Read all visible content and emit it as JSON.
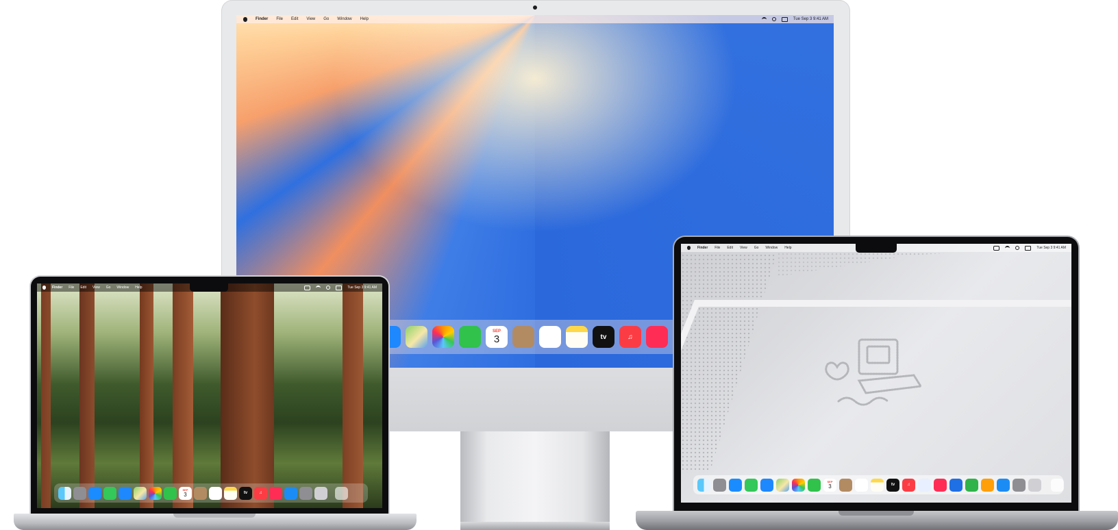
{
  "imac": {
    "menubar": {
      "app": "Finder",
      "items": [
        "File",
        "Edit",
        "View",
        "Go",
        "Window",
        "Help"
      ],
      "clock": "Tue Sep 3  9:41 AM"
    },
    "dock": {
      "calendar": {
        "month": "SEP",
        "day": "3"
      },
      "tv_label": "tv"
    }
  },
  "air": {
    "menubar": {
      "app": "Finder",
      "items": [
        "File",
        "Edit",
        "View",
        "Go",
        "Window",
        "Help"
      ],
      "clock": "Tue Sep 3  9:41 AM"
    },
    "dock": {
      "calendar": {
        "month": "SEP",
        "day": "3"
      },
      "tv_label": "tv"
    }
  },
  "pro": {
    "menubar": {
      "app": "Finder",
      "items": [
        "File",
        "Edit",
        "View",
        "Go",
        "Window",
        "Help"
      ],
      "clock": "Tue Sep 3  9:41 AM"
    },
    "dock": {
      "calendar": {
        "month": "SEP",
        "day": "3"
      },
      "tv_label": "tv"
    }
  },
  "colors": {
    "messages": "#34c759",
    "mail": "#1e88ff",
    "facetime": "#30c24b",
    "music": "#fc3c44",
    "news": "#ff2d55",
    "notes": "#ffd84a",
    "contacts": "#b38b62",
    "appletv": "#111111",
    "safari": "#1a8cff",
    "appstore": "#1c8cf5",
    "settings": "#8e8e93"
  }
}
